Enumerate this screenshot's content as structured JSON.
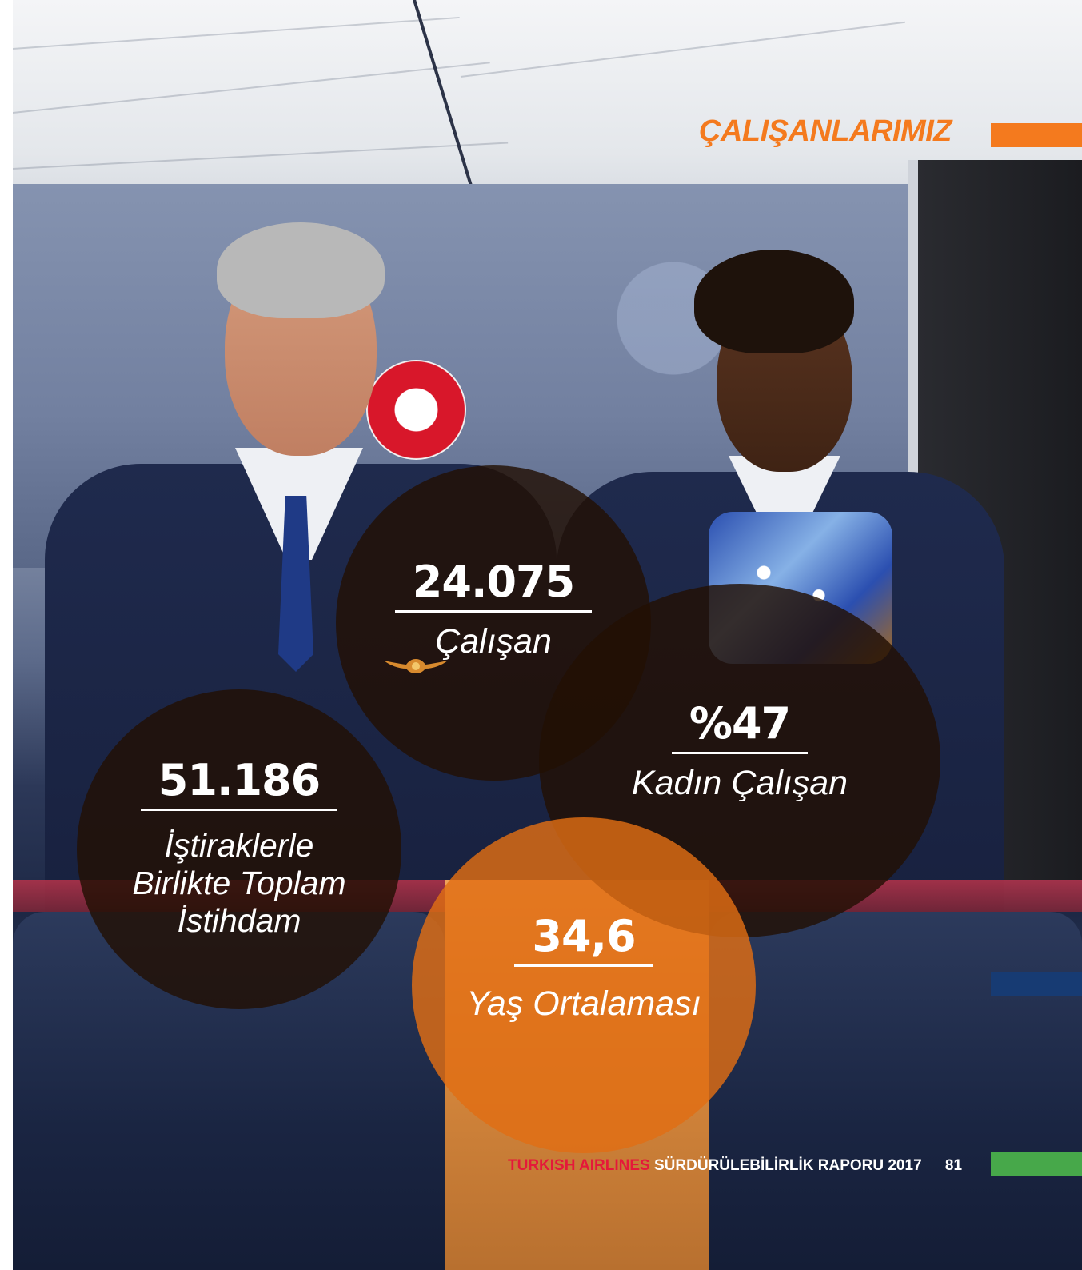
{
  "header": {
    "section_title": "ÇALIŞANLARIMIZ"
  },
  "colors": {
    "accent_orange": "#f47a1e",
    "accent_navy": "#173b73",
    "accent_green": "#47a84a",
    "brand_red": "#e5183a"
  },
  "stats": [
    {
      "value": "24.075",
      "label": "Çalışan"
    },
    {
      "value": "%47",
      "label": "Kadın Çalışan"
    },
    {
      "value": "51.186",
      "label_lines": [
        "İştiraklerle",
        "Birlikte Toplam",
        "İstihdam"
      ]
    },
    {
      "value": "34,6",
      "label": "Yaş Ortalaması"
    }
  ],
  "footer": {
    "brand": "TURKISH AIRLINES",
    "report_title": "SÜRDÜRÜLEBİLİRLİK RAPORU 2017",
    "page_number": "81"
  }
}
